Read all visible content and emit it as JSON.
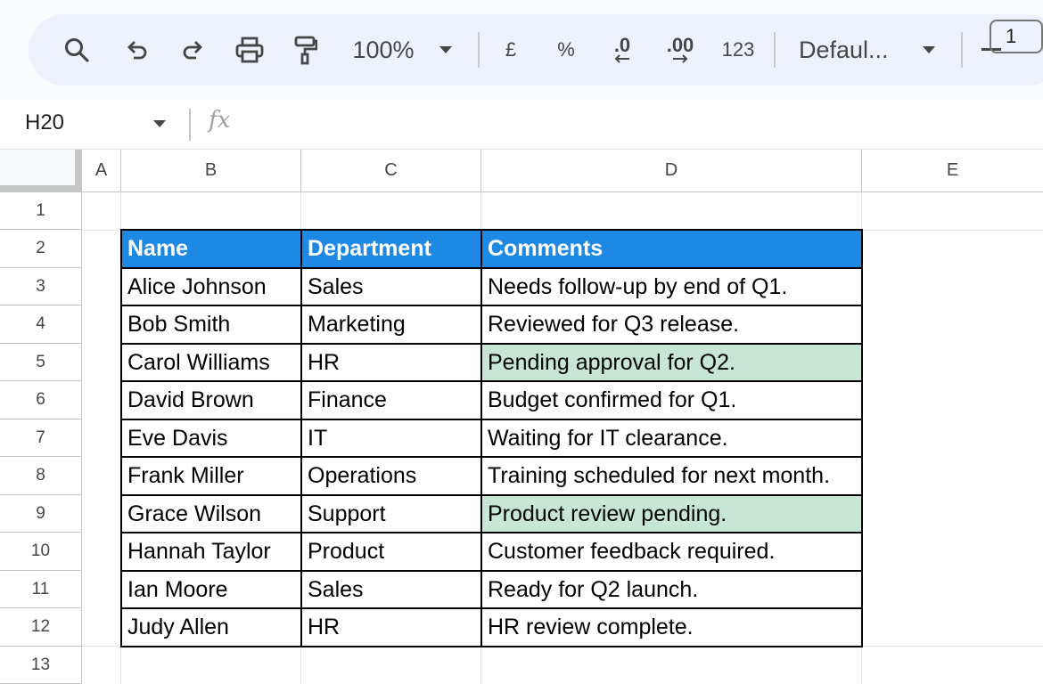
{
  "toolbar": {
    "zoom": "100%",
    "currency": "£",
    "percent": "%",
    "decrease_decimal": ".0",
    "increase_decimal": ".00",
    "number_format": "123",
    "font": "Defaul...",
    "font_size": "1"
  },
  "formula_bar": {
    "cell_ref": "H20",
    "fx_label": "fx",
    "value": ""
  },
  "grid": {
    "columns": [
      "A",
      "B",
      "C",
      "D",
      "E"
    ],
    "rows": [
      "1",
      "2",
      "3",
      "4",
      "5",
      "6",
      "7",
      "8",
      "9",
      "10",
      "11",
      "12",
      "13"
    ]
  },
  "table": {
    "headers": [
      "Name",
      "Department",
      "Comments"
    ],
    "rows": [
      [
        "Alice Johnson",
        "Sales",
        "Needs follow-up by end of Q1."
      ],
      [
        "Bob Smith",
        "Marketing",
        "Reviewed for Q3 release."
      ],
      [
        "Carol Williams",
        "HR",
        "Pending approval for Q2."
      ],
      [
        "David Brown",
        "Finance",
        "Budget confirmed for Q1."
      ],
      [
        "Eve Davis",
        "IT",
        "Waiting for IT clearance."
      ],
      [
        "Frank Miller",
        "Operations",
        "Training scheduled for next month."
      ],
      [
        "Grace Wilson",
        "Support",
        "Product review pending."
      ],
      [
        "Hannah Taylor",
        "Product",
        "Customer feedback required."
      ],
      [
        "Ian Moore",
        "Sales",
        "Ready for Q2 launch."
      ],
      [
        "Judy Allen",
        "HR",
        "HR review complete."
      ]
    ],
    "highlighted_rows": [
      2,
      6
    ]
  },
  "colors": {
    "header_fill": "#1e88e5",
    "highlight_fill": "#c7e6d5",
    "toolbar_bg": "#edf2fa"
  },
  "icons": [
    "search-icon",
    "undo-icon",
    "redo-icon",
    "print-icon",
    "paint-format-icon",
    "chevron-down-icon",
    "minus-icon",
    "fx-icon"
  ]
}
